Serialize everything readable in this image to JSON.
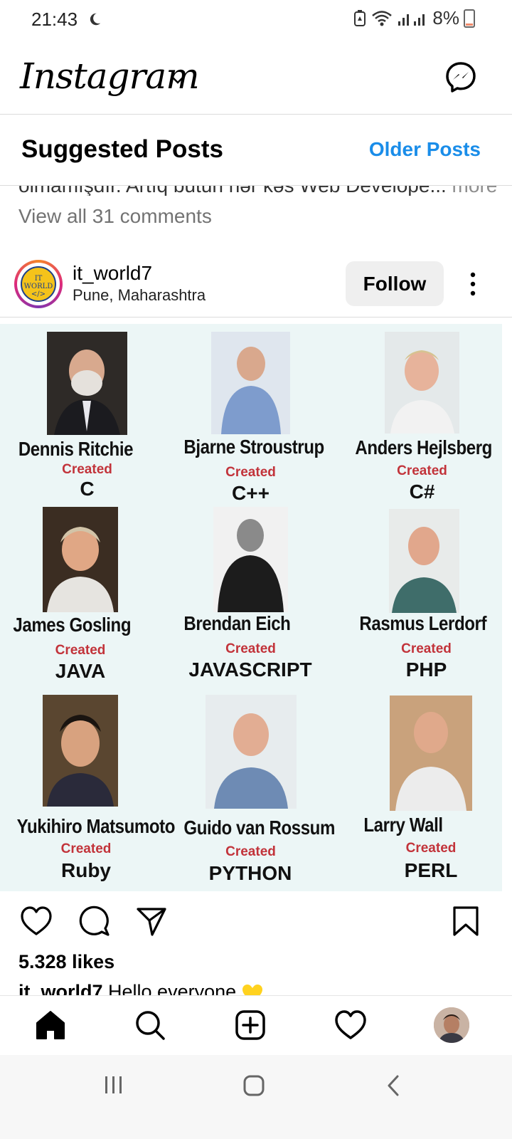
{
  "status_bar": {
    "time": "21:43",
    "battery": "8%"
  },
  "header": {
    "brand": "Instagram"
  },
  "suggested": {
    "title": "Suggested Posts",
    "older_label": "Older Posts"
  },
  "prev_post": {
    "caption_clipped": "olmamışdır. Artıq bütün hər kəs Web Develope...",
    "more": " more",
    "view_all": "View all 31 comments"
  },
  "post": {
    "username": "it_world7",
    "location": "Pune, Maharashtra",
    "follow_label": "Follow",
    "avatar_text": "IT WORLD </>",
    "likes": "5.328 likes",
    "caption_user": "it_world7",
    "caption_text": " Hello everyone"
  },
  "creators": [
    {
      "name": "Dennis Ritchie",
      "created": "Created",
      "language": "C"
    },
    {
      "name": "Bjarne Stroustrup",
      "created": "Created",
      "language": "C++"
    },
    {
      "name": "Anders Hejlsberg",
      "created": "Created",
      "language": "C#"
    },
    {
      "name": "James Gosling",
      "created": "Created",
      "language": "JAVA"
    },
    {
      "name": "Brendan Eich",
      "created": "Created",
      "language": "JAVASCRIPT"
    },
    {
      "name": "Rasmus Lerdorf",
      "created": "Created",
      "language": "PHP"
    },
    {
      "name": "Yukihiro Matsumoto",
      "created": "Created",
      "language": "Ruby"
    },
    {
      "name": "Guido van Rossum",
      "created": "Created",
      "language": "PYTHON"
    },
    {
      "name": "Larry Wall",
      "created": "Created",
      "language": "PERL"
    }
  ],
  "icons": {
    "status": [
      "moon-icon",
      "battery-saver-icon",
      "wifi-icon",
      "signal-icon",
      "battery-icon"
    ],
    "header": [
      "chevron-down-icon",
      "messenger-icon"
    ],
    "actions": [
      "heart-icon",
      "comment-icon",
      "share-icon",
      "bookmark-icon"
    ],
    "nav": [
      "home-icon",
      "search-icon",
      "add-post-icon",
      "activity-heart-icon",
      "profile-avatar"
    ],
    "system": [
      "recent-apps-icon",
      "home-button-icon",
      "back-icon"
    ]
  },
  "colors": {
    "link_blue": "#1a8de9",
    "created_red": "#c2333a",
    "image_bg": "#ecf6f6",
    "follow_bg": "#efefef"
  }
}
